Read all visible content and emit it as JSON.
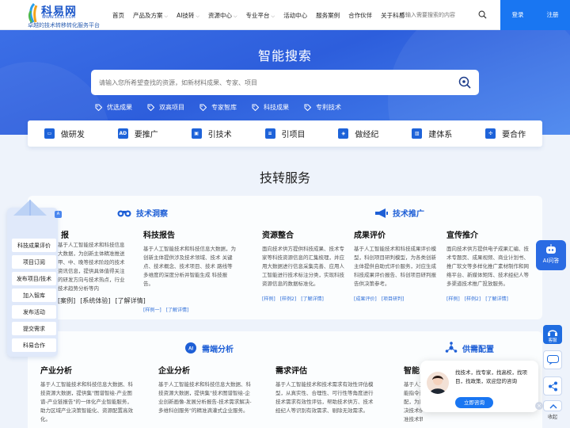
{
  "brand": {
    "name": "科易网",
    "url": "WWW.1633.COM",
    "slogan": "卓越的技术转移转化服务平台",
    "color": "#1b56c9"
  },
  "nav": [
    {
      "label": "首页",
      "caret": false
    },
    {
      "label": "产品及方案",
      "caret": true
    },
    {
      "label": "AI技转",
      "caret": true
    },
    {
      "label": "资源中心",
      "caret": true
    },
    {
      "label": "专业平台",
      "caret": true
    },
    {
      "label": "活动中心",
      "caret": false
    },
    {
      "label": "服务案例",
      "caret": false
    },
    {
      "label": "合作伙伴",
      "caret": false
    },
    {
      "label": "关于科易",
      "caret": false
    }
  ],
  "header_search": {
    "placeholder": "请输入需要搜索的内容"
  },
  "auth": {
    "login": "登录",
    "register": "注册"
  },
  "hero": {
    "title": "智能搜索",
    "search_placeholder": "请输入您所希望查找的资源，如新材料成果、专家、项目",
    "tags": [
      "优选成果",
      "双高项目",
      "专家智库",
      "科技成果",
      "专利技术"
    ]
  },
  "quick_links": [
    {
      "label": "做研发",
      "icon": "monitor-icon"
    },
    {
      "label": "要推广",
      "icon": "ad-icon"
    },
    {
      "label": "引技术",
      "icon": "chip-icon"
    },
    {
      "label": "引项目",
      "icon": "document-icon"
    },
    {
      "label": "做经纪",
      "icon": "handshake-icon"
    },
    {
      "label": "建体系",
      "icon": "building-icon"
    },
    {
      "label": "要合作",
      "icon": "network-icon"
    }
  ],
  "services": {
    "title": "技转服务",
    "groups": [
      {
        "title": "技术洞察",
        "icon": "binoculars-icon"
      },
      {
        "title": "技术推广",
        "icon": "megaphone-icon"
      },
      {
        "title": "需端分析",
        "icon": "ai-icon"
      },
      {
        "title": "供需配置",
        "icon": "network-icon"
      }
    ],
    "cards": [
      {
        "title": "报",
        "desc": "基于人工智能技术和科技信息大数据，为创新主体精准推送甲、中、晚等技术阶段的技术资讯信息，提供具体值得关注的研发方向与技术热点，行业技术趋势分析等内",
        "links": [
          "[案例]",
          "[系统体验]",
          "[了解详情]"
        ]
      },
      {
        "title": "科技报告",
        "desc": "基于人工智能技术和科技信息大数据，为创新主体提供涉及技术领域、技术 关键点、技术概念、技术项目、技术 路线等多维度的深度分析并智能生成 科技报告。",
        "links": [
          "[样例一]",
          "[了解详情]"
        ]
      },
      {
        "title": "资源整合",
        "desc": "面向技术供方提供科技成果、技术专家等科技资源信息的汇集梳理，并应用大数据进行信息采集完善、应用人工智能进行技术标注分类，实现科技资源信息的数据标准化。",
        "links": [
          "[样例]",
          "[样例2]",
          "[了解详情]"
        ]
      },
      {
        "title": "成果评价",
        "desc": "基于人工智能技术和科技成果评价模型，科创项目研判模型，为各类创新主体提供自助式评价服务，对应生成科技成果评价报告、科创项目研判报告供决策参考。",
        "links": [
          "[成果评价]",
          "[项目研判]"
        ]
      },
      {
        "title": "宣传推介",
        "desc": "面向技术供方提供电子成果汇编、技术专题页、成果视频、商业计划书、推广软文等多样化推广素材制作和网络平台、新媒体矩阵、技术经纪人等多渠道技术推广投放服务。",
        "links": [
          "[样例]",
          "[样例2]",
          "[了解详情]"
        ]
      },
      {
        "title": "产业分析",
        "desc": "基于人工智能技术和科技信息大数据、科技资源大数据，提供集\"图谱智绘-产业图谱-产业链报告\"的一体化产业智能服务，助力区域产业决策智能化、资源配置高效化。",
        "links": []
      },
      {
        "title": "企业分析",
        "desc": "基于人工智能技术和科技信息大数据、科技资源大数据，提供集\"技术图谱智绘-企业创新画像-发展分析报告-技术需求解决-多维科创服务\"的精准滴灌式企业服务。",
        "links": []
      },
      {
        "title": "需求评估",
        "desc": "基于人工智能技术和技术需求有效性评估模 型，从真实性、合理性、可行性等角度进行 技术需求有效性评估，帮助技术供方、技术 经纪人等识别有效需求、剔除无效需求。",
        "links": []
      },
      {
        "title": "智能",
        "desc": "基于人工智能技术和科技信息大数据，智能指令进行技术资源与需求的智能化匹配，为用户提供精准的供需对接服务，解决技术供需双方信息不对称问题，实现精准技术转移。",
        "links": []
      }
    ]
  },
  "sidebar": [
    "科技成果评价",
    "项目订阅",
    "发布项目/技术",
    "加入智库",
    "发布活动",
    "提交需求",
    "科易合作"
  ],
  "right_tools": {
    "ai_label": "AI问答",
    "help_label": "客服",
    "collapse_label": "收起"
  },
  "chat": {
    "text": "找技术，找专家，找高校，找项目，找政策，欢迎您的咨询",
    "button": "立即咨询"
  },
  "accent": "#1976f2"
}
